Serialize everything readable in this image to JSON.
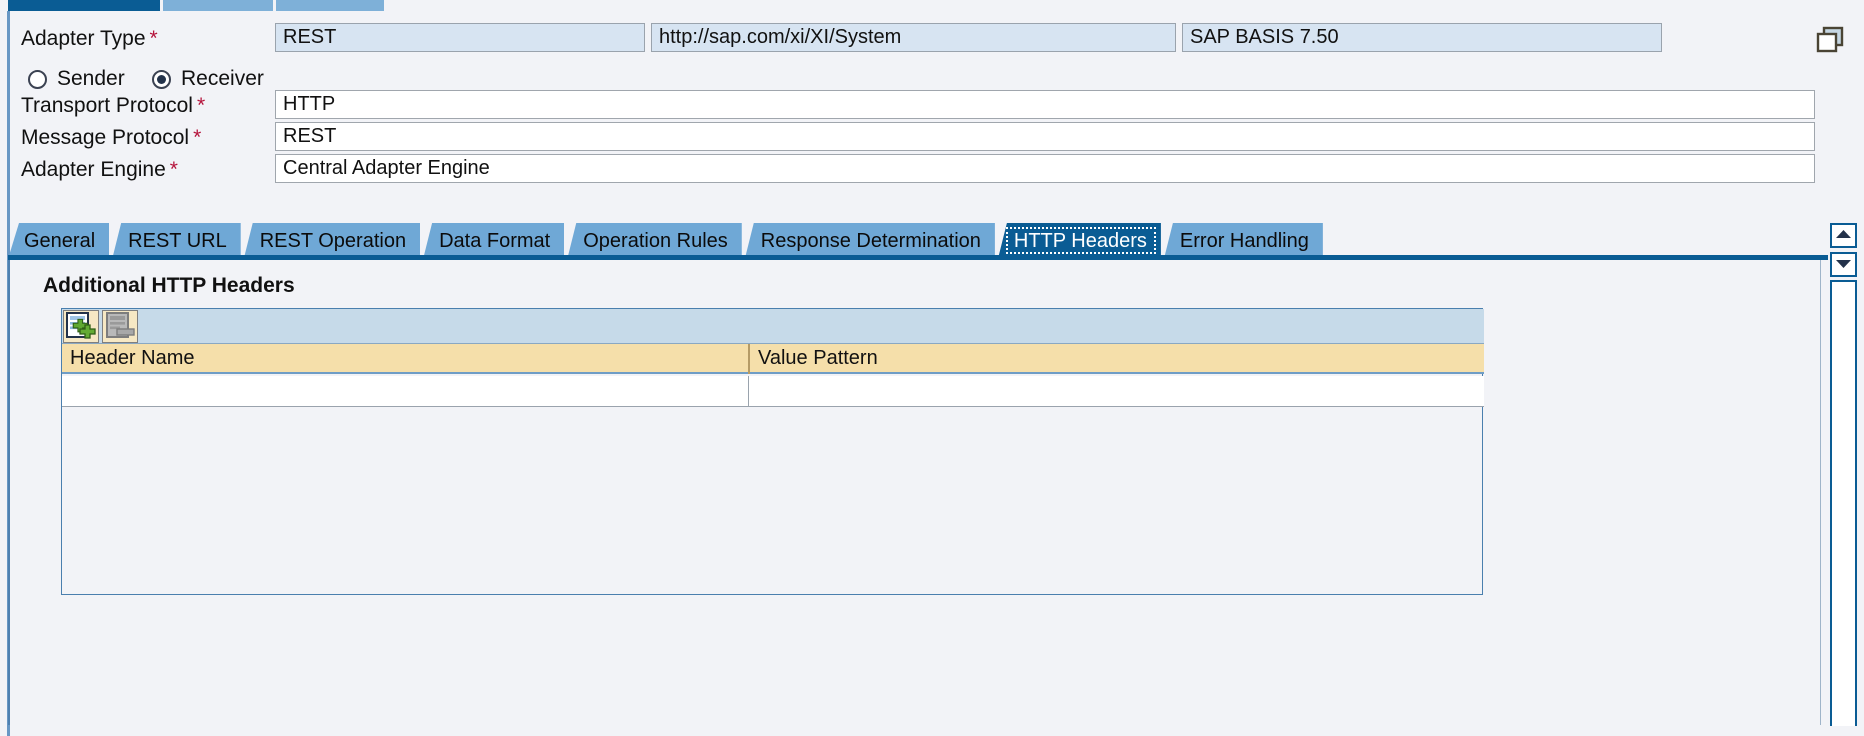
{
  "window": {
    "top_tabs": [
      {
        "name": "active-tab-1",
        "state": "active"
      },
      {
        "name": "inactive-tab-2",
        "state": "inactive"
      },
      {
        "name": "inactive-tab-3",
        "state": "inactive"
      }
    ]
  },
  "form": {
    "adapter_type": {
      "label": "Adapter Type",
      "required": "*",
      "value": "REST",
      "namespace": "http://sap.com/xi/XI/System",
      "software_component": "SAP BASIS 7.50"
    },
    "direction": {
      "sender_label": "Sender",
      "receiver_label": "Receiver",
      "selected": "Receiver"
    },
    "transport_protocol": {
      "label": "Transport Protocol",
      "required": "*",
      "value": "HTTP"
    },
    "message_protocol": {
      "label": "Message Protocol",
      "required": "*",
      "value": "REST"
    },
    "adapter_engine": {
      "label": "Adapter Engine",
      "required": "*",
      "value": "Central Adapter Engine"
    },
    "copy_icon": "copy-icon",
    "value_help_icon": "value-help-icon"
  },
  "tabs": [
    {
      "label": "General",
      "active": false
    },
    {
      "label": "REST URL",
      "active": false
    },
    {
      "label": "REST Operation",
      "active": false
    },
    {
      "label": "Data Format",
      "active": false
    },
    {
      "label": "Operation Rules",
      "active": false
    },
    {
      "label": "Response Determination",
      "active": false
    },
    {
      "label": "HTTP Headers",
      "active": true
    },
    {
      "label": "Error Handling",
      "active": false
    }
  ],
  "content": {
    "section_title": "Additional HTTP Headers",
    "toolbar": {
      "insert_row_icon": "insert-row-icon",
      "delete_row_icon": "delete-row-icon",
      "delete_row_enabled": false
    },
    "table": {
      "columns": [
        "Header Name",
        "Value Pattern"
      ],
      "rows": [
        {
          "header_name": "",
          "value_pattern": ""
        }
      ]
    }
  },
  "scroll": {
    "up_icon": "scroll-up-icon",
    "down_icon": "scroll-down-icon"
  },
  "colors": {
    "accent": "#0a5c94",
    "tab_inactive": "#6fa8d6",
    "readonly_field": "#d7e4f2",
    "table_header": "#f5dfaa",
    "toolbar": "#c6dae9",
    "required_marker": "#b5143c"
  }
}
